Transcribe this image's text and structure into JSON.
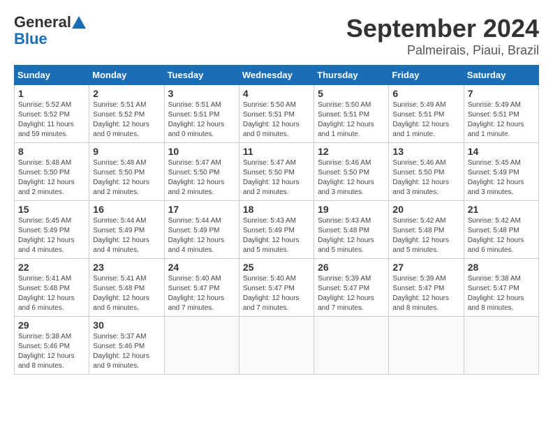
{
  "logo": {
    "text_general": "General",
    "text_blue": "Blue"
  },
  "title": "September 2024",
  "location": "Palmeirais, Piaui, Brazil",
  "weekdays": [
    "Sunday",
    "Monday",
    "Tuesday",
    "Wednesday",
    "Thursday",
    "Friday",
    "Saturday"
  ],
  "weeks": [
    [
      {
        "day": "1",
        "info": "Sunrise: 5:52 AM\nSunset: 5:52 PM\nDaylight: 11 hours\nand 59 minutes."
      },
      {
        "day": "2",
        "info": "Sunrise: 5:51 AM\nSunset: 5:52 PM\nDaylight: 12 hours\nand 0 minutes."
      },
      {
        "day": "3",
        "info": "Sunrise: 5:51 AM\nSunset: 5:51 PM\nDaylight: 12 hours\nand 0 minutes."
      },
      {
        "day": "4",
        "info": "Sunrise: 5:50 AM\nSunset: 5:51 PM\nDaylight: 12 hours\nand 0 minutes."
      },
      {
        "day": "5",
        "info": "Sunrise: 5:50 AM\nSunset: 5:51 PM\nDaylight: 12 hours\nand 1 minute."
      },
      {
        "day": "6",
        "info": "Sunrise: 5:49 AM\nSunset: 5:51 PM\nDaylight: 12 hours\nand 1 minute."
      },
      {
        "day": "7",
        "info": "Sunrise: 5:49 AM\nSunset: 5:51 PM\nDaylight: 12 hours\nand 1 minute."
      }
    ],
    [
      {
        "day": "8",
        "info": "Sunrise: 5:48 AM\nSunset: 5:50 PM\nDaylight: 12 hours\nand 2 minutes."
      },
      {
        "day": "9",
        "info": "Sunrise: 5:48 AM\nSunset: 5:50 PM\nDaylight: 12 hours\nand 2 minutes."
      },
      {
        "day": "10",
        "info": "Sunrise: 5:47 AM\nSunset: 5:50 PM\nDaylight: 12 hours\nand 2 minutes."
      },
      {
        "day": "11",
        "info": "Sunrise: 5:47 AM\nSunset: 5:50 PM\nDaylight: 12 hours\nand 2 minutes."
      },
      {
        "day": "12",
        "info": "Sunrise: 5:46 AM\nSunset: 5:50 PM\nDaylight: 12 hours\nand 3 minutes."
      },
      {
        "day": "13",
        "info": "Sunrise: 5:46 AM\nSunset: 5:50 PM\nDaylight: 12 hours\nand 3 minutes."
      },
      {
        "day": "14",
        "info": "Sunrise: 5:45 AM\nSunset: 5:49 PM\nDaylight: 12 hours\nand 3 minutes."
      }
    ],
    [
      {
        "day": "15",
        "info": "Sunrise: 5:45 AM\nSunset: 5:49 PM\nDaylight: 12 hours\nand 4 minutes."
      },
      {
        "day": "16",
        "info": "Sunrise: 5:44 AM\nSunset: 5:49 PM\nDaylight: 12 hours\nand 4 minutes."
      },
      {
        "day": "17",
        "info": "Sunrise: 5:44 AM\nSunset: 5:49 PM\nDaylight: 12 hours\nand 4 minutes."
      },
      {
        "day": "18",
        "info": "Sunrise: 5:43 AM\nSunset: 5:49 PM\nDaylight: 12 hours\nand 5 minutes."
      },
      {
        "day": "19",
        "info": "Sunrise: 5:43 AM\nSunset: 5:48 PM\nDaylight: 12 hours\nand 5 minutes."
      },
      {
        "day": "20",
        "info": "Sunrise: 5:42 AM\nSunset: 5:48 PM\nDaylight: 12 hours\nand 5 minutes."
      },
      {
        "day": "21",
        "info": "Sunrise: 5:42 AM\nSunset: 5:48 PM\nDaylight: 12 hours\nand 6 minutes."
      }
    ],
    [
      {
        "day": "22",
        "info": "Sunrise: 5:41 AM\nSunset: 5:48 PM\nDaylight: 12 hours\nand 6 minutes."
      },
      {
        "day": "23",
        "info": "Sunrise: 5:41 AM\nSunset: 5:48 PM\nDaylight: 12 hours\nand 6 minutes."
      },
      {
        "day": "24",
        "info": "Sunrise: 5:40 AM\nSunset: 5:47 PM\nDaylight: 12 hours\nand 7 minutes."
      },
      {
        "day": "25",
        "info": "Sunrise: 5:40 AM\nSunset: 5:47 PM\nDaylight: 12 hours\nand 7 minutes."
      },
      {
        "day": "26",
        "info": "Sunrise: 5:39 AM\nSunset: 5:47 PM\nDaylight: 12 hours\nand 7 minutes."
      },
      {
        "day": "27",
        "info": "Sunrise: 5:39 AM\nSunset: 5:47 PM\nDaylight: 12 hours\nand 8 minutes."
      },
      {
        "day": "28",
        "info": "Sunrise: 5:38 AM\nSunset: 5:47 PM\nDaylight: 12 hours\nand 8 minutes."
      }
    ],
    [
      {
        "day": "29",
        "info": "Sunrise: 5:38 AM\nSunset: 5:46 PM\nDaylight: 12 hours\nand 8 minutes."
      },
      {
        "day": "30",
        "info": "Sunrise: 5:37 AM\nSunset: 5:46 PM\nDaylight: 12 hours\nand 9 minutes."
      },
      {
        "day": "",
        "info": ""
      },
      {
        "day": "",
        "info": ""
      },
      {
        "day": "",
        "info": ""
      },
      {
        "day": "",
        "info": ""
      },
      {
        "day": "",
        "info": ""
      }
    ]
  ]
}
